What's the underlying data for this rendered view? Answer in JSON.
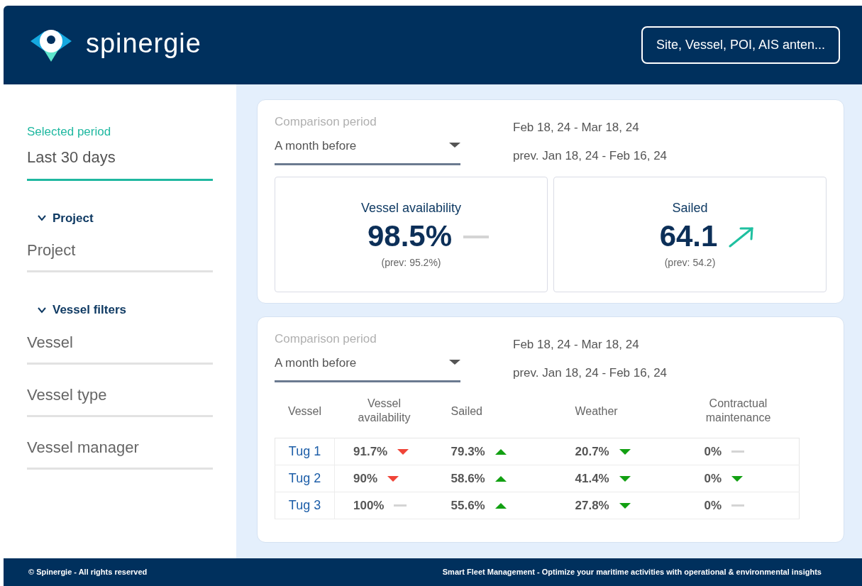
{
  "header": {
    "logo_text": "spinergie",
    "search_button": "Site, Vessel, POI, AIS anten..."
  },
  "sidebar": {
    "period": {
      "label": "Selected period",
      "value": "Last 30 days"
    },
    "sections": [
      {
        "title": "Project",
        "expanded": true,
        "fields": [
          "Project"
        ]
      },
      {
        "title": "Vessel filters",
        "expanded": true,
        "fields": [
          "Vessel",
          "Vessel type",
          "Vessel manager"
        ]
      }
    ]
  },
  "kpi_card": {
    "comparison": {
      "label": "Comparison period",
      "value": "A month before",
      "range": "Feb 18, 24 - Mar 18, 24",
      "prev_range": "prev. Jan 18, 24 - Feb 16, 24"
    },
    "kpis": [
      {
        "title": "Vessel availability",
        "value": "98.5%",
        "prev": "(prev: 95.2%)",
        "kind": "flat"
      },
      {
        "title": "Sailed",
        "value": "64.1",
        "prev": "(prev: 54.2)",
        "kind": "up"
      }
    ]
  },
  "table_card": {
    "comparison": {
      "label": "Comparison period",
      "value": "A month before",
      "range": "Feb 18, 24 - Mar 18, 24",
      "prev_range": "prev. Jan 18, 24 - Feb 16, 24"
    },
    "table": {
      "columns": [
        "Vessel",
        "Vessel availability",
        "Sailed",
        "Weather",
        "Contractual maintenance"
      ],
      "rows": [
        {
          "cells": [
            {
              "value": "Tug 1",
              "kind": "link"
            },
            {
              "value": "91.7%",
              "kind": "down",
              "color": "#f04438"
            },
            {
              "value": "79.3%",
              "kind": "up",
              "color": "#12a012"
            },
            {
              "value": "20.7%",
              "kind": "down",
              "color": "#12a012"
            },
            {
              "value": "0%",
              "kind": "flat",
              "color": "#d4d4d4"
            }
          ]
        },
        {
          "cells": [
            {
              "value": "Tug 2",
              "kind": "link"
            },
            {
              "value": "90%",
              "kind": "down",
              "color": "#f04438"
            },
            {
              "value": "58.6%",
              "kind": "up",
              "color": "#12a012"
            },
            {
              "value": "41.4%",
              "kind": "down",
              "color": "#12a012"
            },
            {
              "value": "0%",
              "kind": "down",
              "color": "#12a012"
            }
          ]
        },
        {
          "cells": [
            {
              "value": "Tug 3",
              "kind": "link"
            },
            {
              "value": "100%",
              "kind": "flat",
              "color": "#d4d4d4"
            },
            {
              "value": "55.6%",
              "kind": "up",
              "color": "#12a012"
            },
            {
              "value": "27.8%",
              "kind": "down",
              "color": "#12a012"
            },
            {
              "value": "0%",
              "kind": "flat",
              "color": "#d4d4d4"
            }
          ]
        }
      ]
    }
  },
  "footer": {
    "left": "© Spinergie - All rights reserved",
    "right": "Smart Fleet Management - Optimize your maritime activities with operational & environmental insights"
  }
}
